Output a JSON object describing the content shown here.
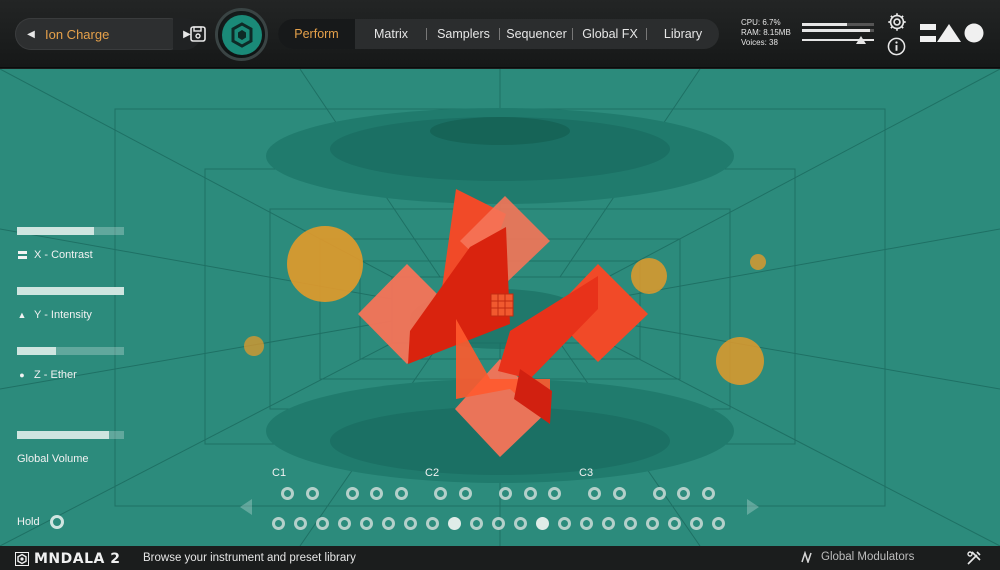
{
  "preset": {
    "name": "Ion Charge",
    "prev_icon": "chevron-left-icon",
    "next_icon": "chevron-right-icon"
  },
  "toolbar": {
    "save_icon": "save-icon",
    "logo_icon": "mndala-hex-logo-icon"
  },
  "tabs": [
    {
      "label": "Perform",
      "active": true
    },
    {
      "label": "Matrix",
      "active": false
    },
    {
      "label": "Samplers",
      "active": false
    },
    {
      "label": "Sequencer",
      "active": false
    },
    {
      "label": "Global FX",
      "active": false
    },
    {
      "label": "Library",
      "active": false
    }
  ],
  "stats": {
    "cpu": "CPU: 6.7%",
    "ram": "RAM: 8.15MB",
    "voices": "Voices: 38"
  },
  "meter": {
    "level_l": 0.62,
    "level_r": 0.95,
    "output_level": 0.82
  },
  "colors": {
    "accent": "#e6a14a",
    "stage": "#2c8b7c",
    "mandala_red": "#f03a1a",
    "orb": "#e29a2a"
  },
  "sliders": [
    {
      "label": "X - Contrast",
      "icon": "equals-icon",
      "value": 0.72
    },
    {
      "label": "Y - Intensity",
      "icon": "triangle-icon",
      "value": 1.0
    },
    {
      "label": "Z - Ether",
      "icon": "circle-icon",
      "value": 0.36
    },
    {
      "label": "Global Volume",
      "icon": "",
      "value": 0.86
    }
  ],
  "hold": {
    "label": "Hold",
    "on": false
  },
  "keyboard": {
    "octave_labels": [
      "C1",
      "C2",
      "C3"
    ],
    "active_keys_row2": [
      8,
      12
    ]
  },
  "footer": {
    "app_name": "MNDALA 2",
    "hint": "Browse your instrument and preset library",
    "global_modulators": "Global Modulators"
  }
}
